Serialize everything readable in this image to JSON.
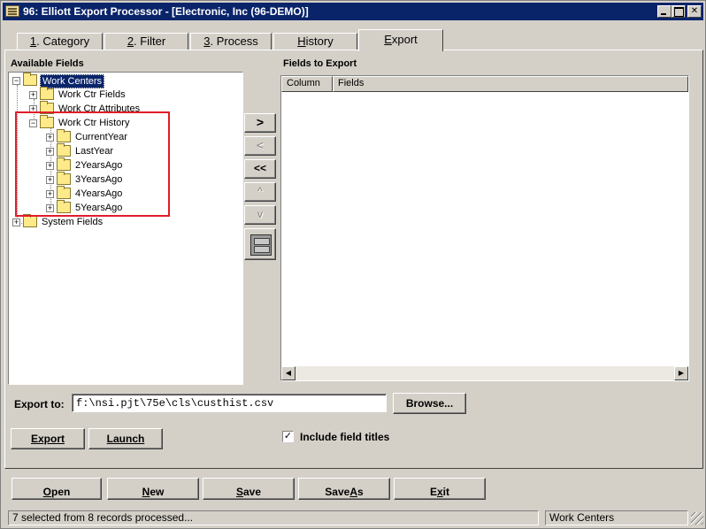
{
  "window": {
    "title": "96: Elliott Export Processor - [Electronic, Inc (96-DEMO)]"
  },
  "tabs": [
    {
      "label": "1. Category",
      "accel": "1",
      "rest": ". Category"
    },
    {
      "label": "2. Filter",
      "accel": "2",
      "rest": ". Filter"
    },
    {
      "label": "3. Process",
      "accel": "3",
      "rest": ". Process"
    },
    {
      "label": "History",
      "accel": "H",
      "rest": "istory"
    },
    {
      "label": "Export",
      "accel": "E",
      "rest": "xport",
      "active": true
    }
  ],
  "available_fields": {
    "label": "Available Fields",
    "tree": [
      {
        "label": "Work Centers",
        "selected": true
      },
      {
        "label": "Work Ctr Fields"
      },
      {
        "label": "Work Ctr Attributes"
      },
      {
        "label": "Work Ctr History"
      },
      {
        "label": "CurrentYear"
      },
      {
        "label": "LastYear"
      },
      {
        "label": "2YearsAgo"
      },
      {
        "label": "3YearsAgo"
      },
      {
        "label": "4YearsAgo"
      },
      {
        "label": "5YearsAgo"
      },
      {
        "label": "System Fields"
      }
    ]
  },
  "move_buttons": {
    "add": ">",
    "remove": "<",
    "remove_all": "<<",
    "up": "^",
    "down": "v"
  },
  "fields_to_export": {
    "label": "Fields to Export",
    "columns": [
      "Column",
      "Fields"
    ]
  },
  "export_to": {
    "label": "Export to:",
    "value": "f:\\nsi.pjt\\75e\\cls\\custhist.csv",
    "browse_label": "Browse..."
  },
  "actions": {
    "export_label": "Export",
    "launch_label": "Launch",
    "include_titles_label": "Include field titles",
    "include_titles_checked": true
  },
  "bottom_buttons": [
    {
      "label": "Open",
      "accel": "O",
      "rest": "pen"
    },
    {
      "label": "New",
      "accel": "N",
      "rest": "ew"
    },
    {
      "label": "Save",
      "accel": "S",
      "rest": "ave"
    },
    {
      "label": "Save As",
      "pre": "Save ",
      "accel": "A",
      "rest": "s"
    },
    {
      "label": "Exit",
      "pre": "E",
      "accel": "x",
      "rest": "it"
    }
  ],
  "status": {
    "message": "7 selected from 8 records processed...",
    "context": "Work Centers"
  },
  "icons": {
    "app": "export-document-icon",
    "folder": "folder-icon",
    "filing_cabinet": "filing-cabinet-icon"
  },
  "colors": {
    "titlebar": "#0a246a",
    "highlight_box": "#e01e2a",
    "face": "#d4d0c8"
  }
}
